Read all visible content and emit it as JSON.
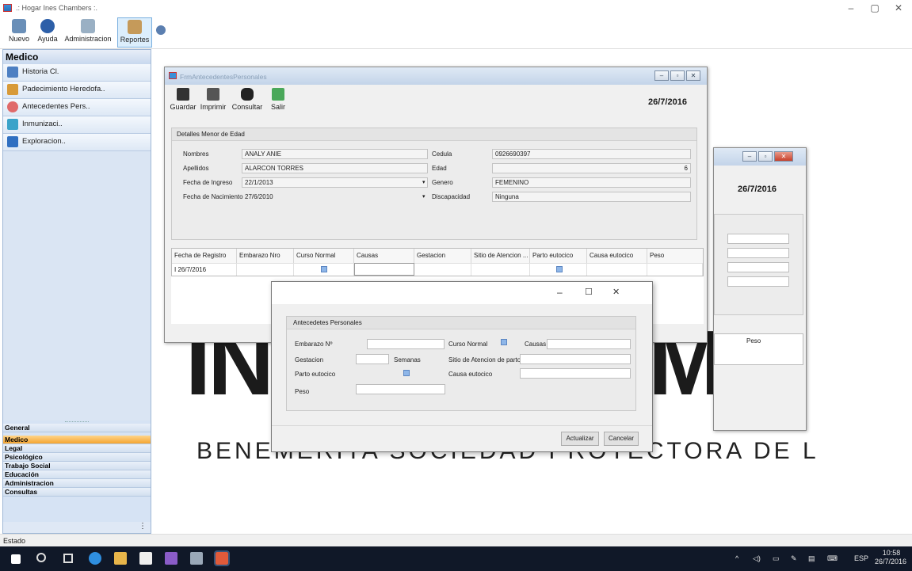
{
  "window": {
    "title": ".: Hogar Ines Chambers :."
  },
  "toolbar": {
    "items": [
      "Nuevo",
      "Ayuda",
      "Administracion",
      "Reportes"
    ]
  },
  "sidebar": {
    "header": "Medico",
    "items": [
      "Historia Cl.",
      "Padecimiento Heredofa..",
      "Antecedentes Pers..",
      "Inmunizaci..",
      "Exploracion.."
    ],
    "categories": [
      "General",
      "Medico",
      "Legal",
      "Psicológico",
      "Trabajo Social",
      "Educación",
      "Administracion",
      "Consultas"
    ],
    "active_category": "Medico"
  },
  "watermark": {
    "big_left": "IN",
    "big_right": "MB",
    "subtitle": "BENEMERITA SOCIEDAD PROTECTORA DE L"
  },
  "back_window": {
    "date": "26/7/2016",
    "grid_header": "Peso"
  },
  "main_window": {
    "title": "FrmAntecedentesPersonales",
    "toolbar": [
      "Guardar",
      "Imprimir",
      "Consultar",
      "Salir"
    ],
    "date": "26/7/2016",
    "group_title": "Detalles Menor de Edad",
    "fields": {
      "nombres_label": "Nombres",
      "nombres": "ANALY ANIE",
      "apellidos_label": "Apellidos",
      "apellidos": "ALARCON TORRES",
      "ingreso_label": "Fecha de Ingreso",
      "ingreso": "22/1/2013",
      "nacimiento_label": "Fecha de Nacimiento",
      "nacimiento": "27/6/2010",
      "cedula_label": "Cedula",
      "cedula": "0926690397",
      "edad_label": "Edad",
      "edad": "6",
      "genero_label": "Genero",
      "genero": "FEMENINO",
      "discapacidad_label": "Discapacidad",
      "discapacidad": "Ninguna"
    },
    "grid": {
      "columns": [
        "Fecha de Registro",
        "Embarazo Nro",
        "Curso Normal",
        "Causas",
        "Gestacion",
        "Sitio de Atencion ...",
        "Parto eutocico",
        "Causa eutocico",
        "Peso"
      ],
      "row_marker": "I",
      "rows": [
        [
          "26/7/2016",
          "",
          "",
          "",
          "",
          "",
          "",
          "",
          ""
        ]
      ]
    }
  },
  "dialog": {
    "group_title": "Antecedetes Personales",
    "labels": {
      "embarazo": "Embarazo Nº",
      "gestacion": "Gestacion",
      "semanas": "Semanas",
      "parto": "Parto eutocico",
      "peso": "Peso",
      "curso": "Curso Normal",
      "causas": "Causas",
      "sitio": "Sitio de Atencion de parto",
      "causa_eutocico": "Causa eutocico"
    },
    "buttons": {
      "update": "Actualizar",
      "cancel": "Cancelar"
    }
  },
  "status": {
    "text": "Estado"
  },
  "taskbar": {
    "time": "10:58",
    "date": "26/7/2016",
    "lang": "ESP"
  }
}
